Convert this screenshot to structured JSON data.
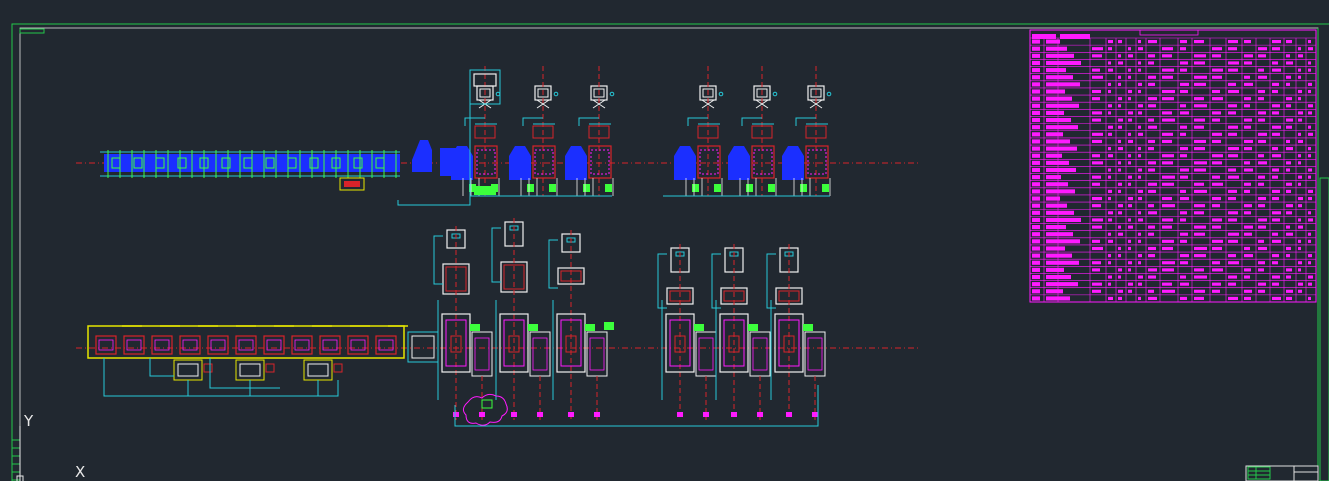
{
  "app": {
    "view": "model-space",
    "background_color": "#212830"
  },
  "ucs": {
    "y_label": "Y",
    "x_label": "X",
    "icon": "ucs-axis-icon"
  },
  "drawing": {
    "frame_color": "#22c84a",
    "centerline_color": "#d8232a",
    "pipe_color": "#27c9d8",
    "equipment_red": "#d8232a",
    "equipment_blue": "#1b2fff",
    "equipment_magenta": "#ff1aff",
    "equipment_green": "#3cff3c",
    "equipment_white": "#f0f0f0",
    "equipment_yellow": "#e6e600",
    "table_color": "#ff1aff"
  },
  "table": {
    "rows": 37,
    "columns": 20,
    "icon": "equipment-list-table"
  },
  "title_block": {
    "icon": "title-block"
  }
}
